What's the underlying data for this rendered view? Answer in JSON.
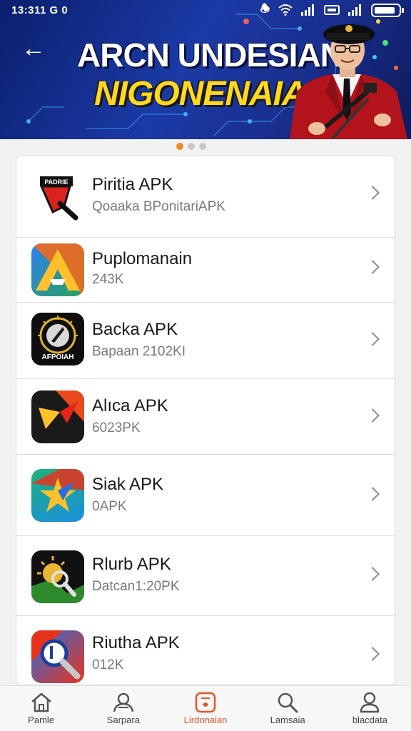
{
  "status_bar": {
    "time": "13:311 G 0",
    "icons": [
      "mute-icon",
      "wifi-icon",
      "signal-icon",
      "vpn-icon",
      "signal-icon",
      "battery-icon"
    ]
  },
  "banner": {
    "title_line1": "ARCN UNDESIAN",
    "title_line2": "NIGONENAIAN",
    "slide_count": 3,
    "active_slide": 0
  },
  "apps": [
    {
      "name": "Piritia APK",
      "sub": "Qoaaka BPonitariAPK",
      "icon": "red-pen-icon"
    },
    {
      "name": "Puplomanain",
      "sub": "243K",
      "icon": "a-triangle-icon"
    },
    {
      "name": "Backa APK",
      "sub": "Bapaan 2102KI",
      "icon": "badge-emblem-icon",
      "icon_text": "AFPOIAH"
    },
    {
      "name": "Alıca APK",
      "sub": "6023PK",
      "icon": "x-arrow-icon"
    },
    {
      "name": "Siak APK",
      "sub": "0APK",
      "icon": "star-burst-icon"
    },
    {
      "name": "Rlurb APK",
      "sub": "Datcan1:20PK",
      "icon": "sun-magnifier-icon"
    },
    {
      "name": "Riutha APK",
      "sub": "012K",
      "icon": "magnifier-tool-icon"
    }
  ],
  "bottom_nav": [
    {
      "label": "Pamle",
      "icon": "home-icon",
      "active": false
    },
    {
      "label": "Sarpara",
      "icon": "profile-group-icon",
      "active": false
    },
    {
      "label": "Lirdonaian",
      "icon": "app-square-icon",
      "active": true
    },
    {
      "label": "Lamsaia",
      "icon": "search-icon",
      "active": false
    },
    {
      "label": "blacdata",
      "icon": "user-icon",
      "active": false
    }
  ],
  "colors": {
    "banner_bg": "#1b3aa6",
    "accent": "#f08a24",
    "active_nav": "#e2552a",
    "title_yellow": "#ffd81f"
  }
}
